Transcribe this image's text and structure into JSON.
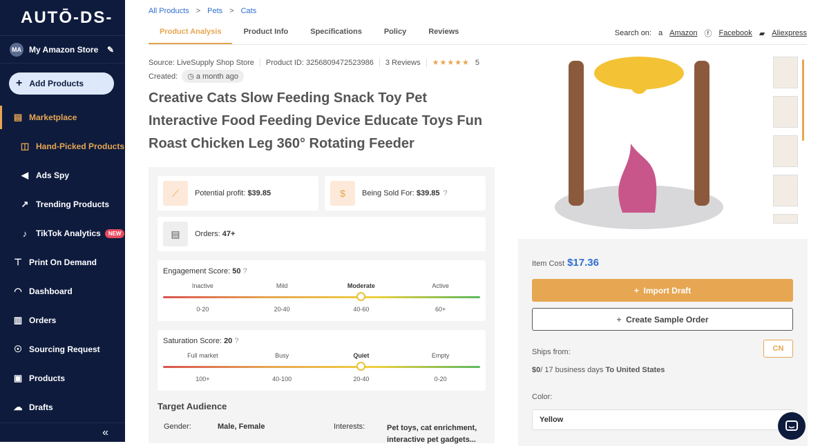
{
  "sidebar": {
    "logo": "AUTŌ-DS-",
    "store_initials": "MA",
    "store_name": "My Amazon Store",
    "add_products": "Add Products",
    "items": [
      {
        "label": "Marketplace"
      },
      {
        "label": "Hand-Picked Products"
      },
      {
        "label": "Ads Spy"
      },
      {
        "label": "Trending Products"
      },
      {
        "label": "TikTok Analytics",
        "badge": "NEW"
      },
      {
        "label": "Print On Demand"
      },
      {
        "label": "Dashboard"
      },
      {
        "label": "Orders"
      },
      {
        "label": "Sourcing Request"
      },
      {
        "label": "Products"
      },
      {
        "label": "Drafts"
      }
    ],
    "collapse": "«"
  },
  "breadcrumb": [
    "All Products",
    ">",
    "Pets",
    ">",
    "Cats"
  ],
  "tabs": [
    "Product Analysis",
    "Product Info",
    "Specifications",
    "Policy",
    "Reviews"
  ],
  "search_on": {
    "label": "Search on:",
    "links": [
      "Amazon",
      "Facebook",
      "Aliexpress"
    ]
  },
  "meta": {
    "source": "Source: LiveSupply Shop Store",
    "product_id": "Product ID: 3256809472523986",
    "reviews": "3 Reviews",
    "stars": "★★★★★",
    "rating": "5",
    "created_label": "Created:",
    "created_value": "a month ago"
  },
  "title": "Creative Cats Slow Feeding Snack Toy Pet Interactive Food Feeding Device Educate Toys Fun Roast Chicken Leg 360° Rotating Feeder",
  "stats": {
    "profit_label": "Potential profit:",
    "profit_value": "$39.85",
    "sold_label": "Being Sold For:",
    "sold_value": "$39.85",
    "orders_label": "Orders:",
    "orders_value": "47+"
  },
  "engagement": {
    "label": "Engagement Score:",
    "value": "50",
    "levels": [
      "Inactive",
      "Mild",
      "Moderate",
      "Active"
    ],
    "ranges": [
      "0-20",
      "20-40",
      "40-60",
      "60+"
    ]
  },
  "saturation": {
    "label": "Saturation Score:",
    "value": "20",
    "levels": [
      "Full market",
      "Busy",
      "Quiet",
      "Empty"
    ],
    "ranges": [
      "100+",
      "40-100",
      "20-40",
      "0-20"
    ]
  },
  "audience": {
    "title": "Target Audience",
    "gender_label": "Gender:",
    "gender_value": "Male, Female",
    "interests_label": "Interests:",
    "interests_value": "Pet toys, cat enrichment, interactive pet gadgets..."
  },
  "buy": {
    "cost_label": "Item Cost",
    "cost_value": "$17.36",
    "import": "Import Draft",
    "sample": "Create Sample Order",
    "ships_label": "Ships from:",
    "ships_country": "CN",
    "ship_price": "$0",
    "ship_days": "/ 17 business days",
    "ship_dest": "To United States",
    "color_label": "Color:",
    "color_value": "Yellow"
  }
}
